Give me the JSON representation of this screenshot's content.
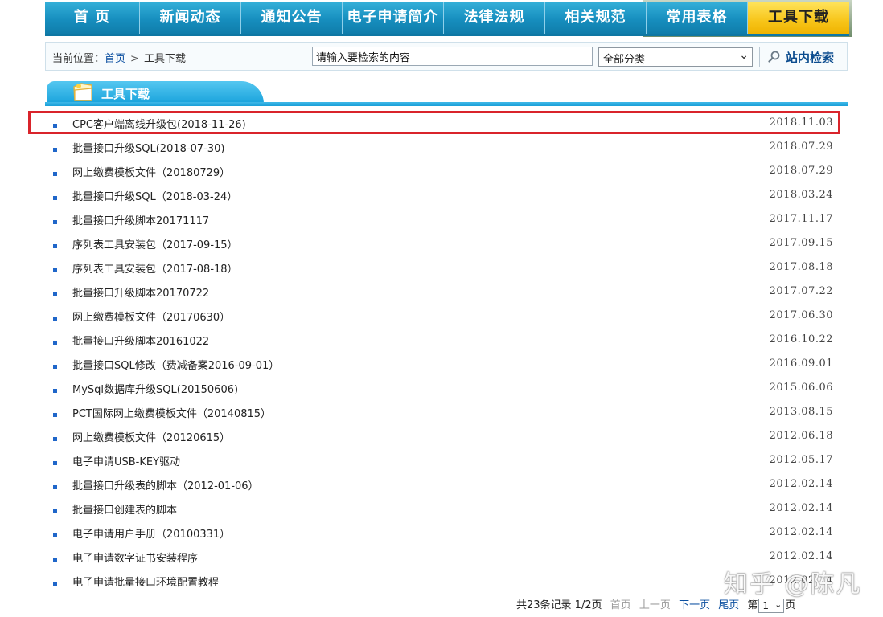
{
  "nav": {
    "items": [
      {
        "label": "首 页"
      },
      {
        "label": "新闻动态"
      },
      {
        "label": "通知公告"
      },
      {
        "label": "电子申请简介"
      },
      {
        "label": "法律法规"
      },
      {
        "label": "相关规范"
      },
      {
        "label": "常用表格"
      },
      {
        "label": "工具下载"
      }
    ],
    "active_index": 7
  },
  "breadcrumb": {
    "prefix": "当前位置：",
    "home": "首页",
    "separator": ">",
    "current": "工具下载"
  },
  "search": {
    "value": "请输入要检索的内容",
    "category": "全部分类",
    "button_label": "站内检索"
  },
  "section": {
    "title": "工具下载"
  },
  "items": [
    {
      "title": "CPC客户端离线升级包(2018-11-26)",
      "date": "2018.11.03"
    },
    {
      "title": "批量接口升级SQL(2018-07-30)",
      "date": "2018.07.29"
    },
    {
      "title": "网上缴费模板文件（20180729）",
      "date": "2018.07.29"
    },
    {
      "title": "批量接口升级SQL（2018-03-24）",
      "date": "2018.03.24"
    },
    {
      "title": "批量接口升级脚本20171117",
      "date": "2017.11.17"
    },
    {
      "title": "序列表工具安装包（2017-09-15）",
      "date": "2017.09.15"
    },
    {
      "title": "序列表工具安装包（2017-08-18）",
      "date": "2017.08.18"
    },
    {
      "title": "批量接口升级脚本20170722",
      "date": "2017.07.22"
    },
    {
      "title": "网上缴费模板文件（20170630）",
      "date": "2017.06.30"
    },
    {
      "title": "批量接口升级脚本20161022",
      "date": "2016.10.22"
    },
    {
      "title": "批量接口SQL修改（费减备案2016-09-01）",
      "date": "2016.09.01"
    },
    {
      "title": "MySql数据库升级SQL(20150606)",
      "date": "2015.06.06"
    },
    {
      "title": "PCT国际网上缴费模板文件（20140815）",
      "date": "2013.08.15"
    },
    {
      "title": "网上缴费模板文件（20120615）",
      "date": "2012.06.18"
    },
    {
      "title": "电子申请USB-KEY驱动",
      "date": "2012.05.17"
    },
    {
      "title": "批量接口升级表的脚本（2012-01-06）",
      "date": "2012.02.14"
    },
    {
      "title": "批量接口创建表的脚本",
      "date": "2012.02.14"
    },
    {
      "title": "电子申请用户手册（20100331）",
      "date": "2012.02.14"
    },
    {
      "title": "电子申请数字证书安装程序",
      "date": "2012.02.14"
    },
    {
      "title": "电子申请批量接口环境配置教程",
      "date": "2012.02.14"
    }
  ],
  "highlighted_index": 0,
  "pagination": {
    "summary": "共23条记录 1/2页",
    "first": "首页",
    "prev": "上一页",
    "next": "下一页",
    "last": "尾页",
    "page_prefix": "第",
    "page_value": "1",
    "page_suffix": "页"
  },
  "watermark": "知乎 @陈凡",
  "colors": {
    "nav_blue": "#178fbf",
    "nav_active": "#f7c51a",
    "link": "#0b4fa0",
    "highlight": "#d9242b"
  }
}
